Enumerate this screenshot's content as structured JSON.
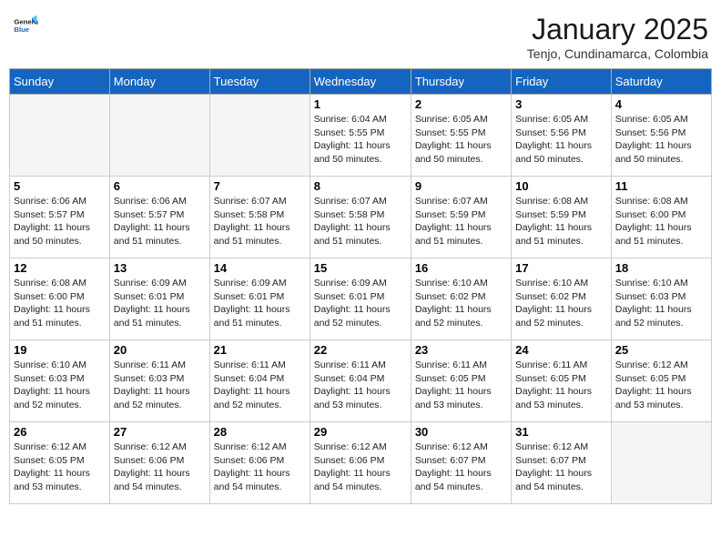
{
  "header": {
    "logo_general": "General",
    "logo_blue": "Blue",
    "month": "January 2025",
    "location": "Tenjo, Cundinamarca, Colombia"
  },
  "weekdays": [
    "Sunday",
    "Monday",
    "Tuesday",
    "Wednesday",
    "Thursday",
    "Friday",
    "Saturday"
  ],
  "weeks": [
    [
      {
        "day": "",
        "info": ""
      },
      {
        "day": "",
        "info": ""
      },
      {
        "day": "",
        "info": ""
      },
      {
        "day": "1",
        "info": "Sunrise: 6:04 AM\nSunset: 5:55 PM\nDaylight: 11 hours and 50 minutes."
      },
      {
        "day": "2",
        "info": "Sunrise: 6:05 AM\nSunset: 5:55 PM\nDaylight: 11 hours and 50 minutes."
      },
      {
        "day": "3",
        "info": "Sunrise: 6:05 AM\nSunset: 5:56 PM\nDaylight: 11 hours and 50 minutes."
      },
      {
        "day": "4",
        "info": "Sunrise: 6:05 AM\nSunset: 5:56 PM\nDaylight: 11 hours and 50 minutes."
      }
    ],
    [
      {
        "day": "5",
        "info": "Sunrise: 6:06 AM\nSunset: 5:57 PM\nDaylight: 11 hours and 50 minutes."
      },
      {
        "day": "6",
        "info": "Sunrise: 6:06 AM\nSunset: 5:57 PM\nDaylight: 11 hours and 51 minutes."
      },
      {
        "day": "7",
        "info": "Sunrise: 6:07 AM\nSunset: 5:58 PM\nDaylight: 11 hours and 51 minutes."
      },
      {
        "day": "8",
        "info": "Sunrise: 6:07 AM\nSunset: 5:58 PM\nDaylight: 11 hours and 51 minutes."
      },
      {
        "day": "9",
        "info": "Sunrise: 6:07 AM\nSunset: 5:59 PM\nDaylight: 11 hours and 51 minutes."
      },
      {
        "day": "10",
        "info": "Sunrise: 6:08 AM\nSunset: 5:59 PM\nDaylight: 11 hours and 51 minutes."
      },
      {
        "day": "11",
        "info": "Sunrise: 6:08 AM\nSunset: 6:00 PM\nDaylight: 11 hours and 51 minutes."
      }
    ],
    [
      {
        "day": "12",
        "info": "Sunrise: 6:08 AM\nSunset: 6:00 PM\nDaylight: 11 hours and 51 minutes."
      },
      {
        "day": "13",
        "info": "Sunrise: 6:09 AM\nSunset: 6:01 PM\nDaylight: 11 hours and 51 minutes."
      },
      {
        "day": "14",
        "info": "Sunrise: 6:09 AM\nSunset: 6:01 PM\nDaylight: 11 hours and 51 minutes."
      },
      {
        "day": "15",
        "info": "Sunrise: 6:09 AM\nSunset: 6:01 PM\nDaylight: 11 hours and 52 minutes."
      },
      {
        "day": "16",
        "info": "Sunrise: 6:10 AM\nSunset: 6:02 PM\nDaylight: 11 hours and 52 minutes."
      },
      {
        "day": "17",
        "info": "Sunrise: 6:10 AM\nSunset: 6:02 PM\nDaylight: 11 hours and 52 minutes."
      },
      {
        "day": "18",
        "info": "Sunrise: 6:10 AM\nSunset: 6:03 PM\nDaylight: 11 hours and 52 minutes."
      }
    ],
    [
      {
        "day": "19",
        "info": "Sunrise: 6:10 AM\nSunset: 6:03 PM\nDaylight: 11 hours and 52 minutes."
      },
      {
        "day": "20",
        "info": "Sunrise: 6:11 AM\nSunset: 6:03 PM\nDaylight: 11 hours and 52 minutes."
      },
      {
        "day": "21",
        "info": "Sunrise: 6:11 AM\nSunset: 6:04 PM\nDaylight: 11 hours and 52 minutes."
      },
      {
        "day": "22",
        "info": "Sunrise: 6:11 AM\nSunset: 6:04 PM\nDaylight: 11 hours and 53 minutes."
      },
      {
        "day": "23",
        "info": "Sunrise: 6:11 AM\nSunset: 6:05 PM\nDaylight: 11 hours and 53 minutes."
      },
      {
        "day": "24",
        "info": "Sunrise: 6:11 AM\nSunset: 6:05 PM\nDaylight: 11 hours and 53 minutes."
      },
      {
        "day": "25",
        "info": "Sunrise: 6:12 AM\nSunset: 6:05 PM\nDaylight: 11 hours and 53 minutes."
      }
    ],
    [
      {
        "day": "26",
        "info": "Sunrise: 6:12 AM\nSunset: 6:05 PM\nDaylight: 11 hours and 53 minutes."
      },
      {
        "day": "27",
        "info": "Sunrise: 6:12 AM\nSunset: 6:06 PM\nDaylight: 11 hours and 54 minutes."
      },
      {
        "day": "28",
        "info": "Sunrise: 6:12 AM\nSunset: 6:06 PM\nDaylight: 11 hours and 54 minutes."
      },
      {
        "day": "29",
        "info": "Sunrise: 6:12 AM\nSunset: 6:06 PM\nDaylight: 11 hours and 54 minutes."
      },
      {
        "day": "30",
        "info": "Sunrise: 6:12 AM\nSunset: 6:07 PM\nDaylight: 11 hours and 54 minutes."
      },
      {
        "day": "31",
        "info": "Sunrise: 6:12 AM\nSunset: 6:07 PM\nDaylight: 11 hours and 54 minutes."
      },
      {
        "day": "",
        "info": ""
      }
    ]
  ]
}
